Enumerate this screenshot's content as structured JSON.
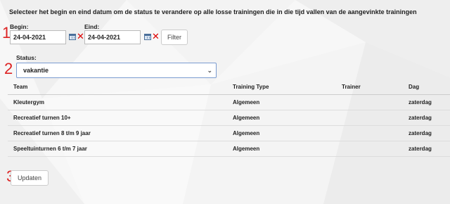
{
  "instruction": "Selecteer het begin en eind datum om de status te verandere op alle losse trainingen die in die tijd vallen van de aangevinkte trainingen",
  "markers": [
    "1",
    "2",
    "3"
  ],
  "begin": {
    "label": "Begin:",
    "value": "24-04-2021"
  },
  "eind": {
    "label": "Eind:",
    "value": "24-04-2021"
  },
  "filter_label": "Filter",
  "status": {
    "label": "Status:",
    "selected": "vakantie"
  },
  "table": {
    "headers": [
      "Team",
      "Training Type",
      "Trainer",
      "Dag"
    ],
    "rows": [
      {
        "team": "Kleutergym",
        "type": "Algemeen",
        "trainer": "",
        "dag": "zaterdag"
      },
      {
        "team": "Recreatief turnen 10+",
        "type": "Algemeen",
        "trainer": "",
        "dag": "zaterdag"
      },
      {
        "team": "Recreatief turnen 8 t/m 9 jaar",
        "type": "Algemeen",
        "trainer": "",
        "dag": "zaterdag"
      },
      {
        "team": "Speeltuinturnen 6 t/m 7 jaar",
        "type": "Algemeen",
        "trainer": "",
        "dag": "zaterdag"
      }
    ]
  },
  "update_label": "Updaten",
  "icons": {
    "calendar": "calendar-icon",
    "clear": "clear-x-icon",
    "dropdown": "chevron-down-icon"
  },
  "colors": {
    "marker": "#dd2222",
    "clear_x": "#dd0000",
    "select_border": "#7a9bd0"
  }
}
